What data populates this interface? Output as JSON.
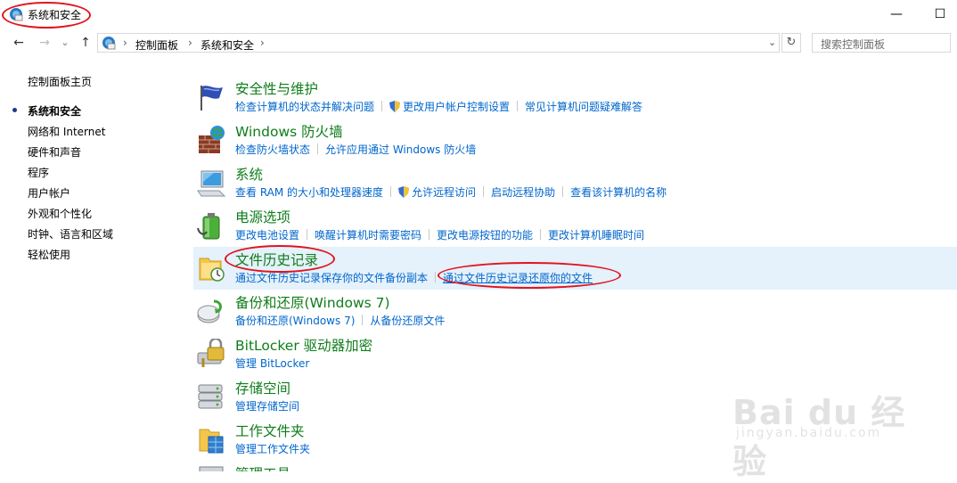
{
  "window": {
    "title": "系统和安全",
    "min_glyph": "—",
    "max_glyph": "☐"
  },
  "navbar": {
    "back_glyph": "←",
    "forward_glyph": "→",
    "recent_glyph": "⌄",
    "up_glyph": "↑",
    "breadcrumb": [
      "控制面板",
      "系统和安全"
    ],
    "sep_glyph": "›",
    "dropdown_glyph": "⌄",
    "refresh_glyph": "↻",
    "search_placeholder": "搜索控制面板"
  },
  "sidebar": {
    "items": [
      {
        "label": "控制面板主页"
      },
      {
        "label": "系统和安全",
        "current": true
      },
      {
        "label": "网络和 Internet"
      },
      {
        "label": "硬件和声音"
      },
      {
        "label": "程序"
      },
      {
        "label": "用户帐户"
      },
      {
        "label": "外观和个性化"
      },
      {
        "label": "时钟、语言和区域"
      },
      {
        "label": "轻松使用"
      }
    ]
  },
  "categories": [
    {
      "title": "安全性与维护",
      "icon": "flag-icon",
      "links": [
        "检查计算机的状态并解决问题",
        "更改用户帐户控制设置",
        "常见计算机问题疑难解答"
      ]
    },
    {
      "title": "Windows 防火墙",
      "icon": "firewall-icon",
      "links": [
        "检查防火墙状态",
        "允许应用通过 Windows 防火墙"
      ]
    },
    {
      "title": "系统",
      "icon": "computer-icon",
      "links": [
        "查看 RAM 的大小和处理器速度",
        "允许远程访问",
        "启动远程协助",
        "查看该计算机的名称"
      ]
    },
    {
      "title": "电源选项",
      "icon": "battery-icon",
      "links": [
        "更改电池设置",
        "唤醒计算机时需要密码",
        "更改电源按钮的功能",
        "更改计算机睡眠时间"
      ]
    },
    {
      "title": "文件历史记录",
      "icon": "file-history-icon",
      "links": [
        "通过文件历史记录保存你的文件备份副本",
        "通过文件历史记录还原你的文件"
      ]
    },
    {
      "title": "备份和还原(Windows 7)",
      "icon": "backup-icon",
      "links": [
        "备份和还原(Windows 7)",
        "从备份还原文件"
      ]
    },
    {
      "title": "BitLocker 驱动器加密",
      "icon": "bitlocker-icon",
      "links": [
        "管理 BitLocker"
      ]
    },
    {
      "title": "存储空间",
      "icon": "storage-icon",
      "links": [
        "管理存储空间"
      ]
    },
    {
      "title": "工作文件夹",
      "icon": "work-folders-icon",
      "links": [
        "管理工作文件夹"
      ]
    },
    {
      "title": "管理工具",
      "icon": "admin-tools-icon",
      "links": []
    }
  ],
  "watermark": {
    "brand": "Bai du 经验",
    "sub": "jingyan.baidu.com"
  },
  "colors": {
    "category_title": "#0f7d1a",
    "link": "#0066cc",
    "highlight": "#e5f1fb",
    "annotation": "#e0141e"
  }
}
